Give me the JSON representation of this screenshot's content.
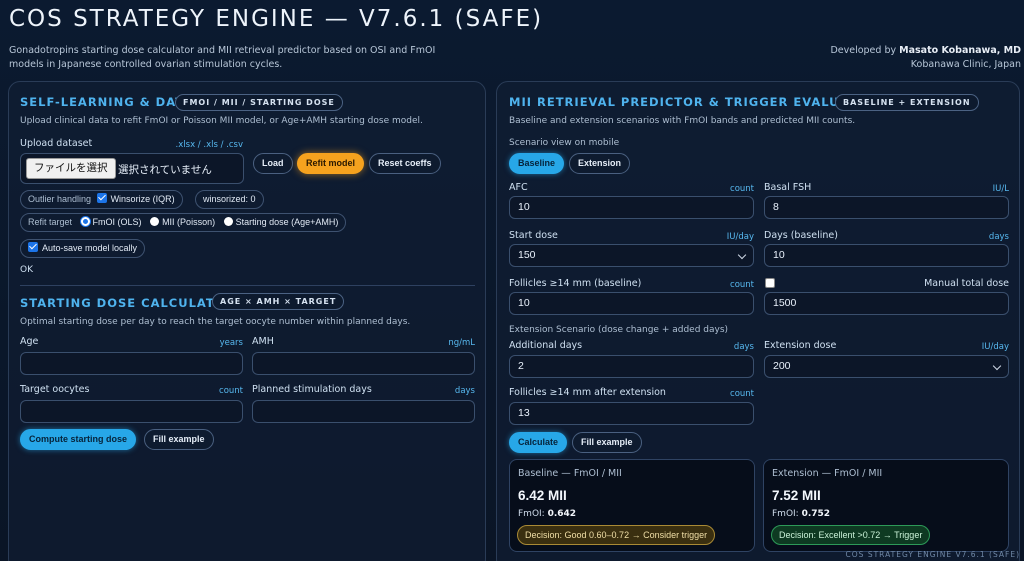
{
  "header": {
    "title": "COS STRATEGY ENGINE — V7.6.1 (SAFE)",
    "subtitle": "Gonadotropins starting dose calculator and MII retrieval predictor based on OSI and FmOI models in Japanese controlled ovarian stimulation cycles.",
    "developed_by_prefix": "Developed by ",
    "developer": "Masato Kobanawa, MD",
    "clinic": "Kobanawa Clinic, Japan"
  },
  "self_learning": {
    "title": "SELF-LEARNING & DATA",
    "tag": "FMOI / MII / STARTING DOSE",
    "desc": "Upload clinical data to refit FmOI or Poisson MII model, or Age+AMH starting dose model.",
    "upload_label": "Upload dataset",
    "upload_formats": ".xlsx / .xls / .csv",
    "file_button": "ファイルを選択",
    "file_none": "選択されていません",
    "load": "Load",
    "refit": "Refit model",
    "reset": "Reset coeffs",
    "outlier_label": "Outlier handling",
    "winsorize_label": "Winsorize (IQR)",
    "winsorize_checked": true,
    "winsorized_count": "winsorized: 0",
    "refit_target_label": "Refit target",
    "refit_options": [
      "FmOI (OLS)",
      "MII (Poisson)",
      "Starting dose (Age+AMH)"
    ],
    "refit_selected": "FmOI (OLS)",
    "autosave_label": "Auto-save model locally",
    "autosave_checked": true,
    "status": "OK"
  },
  "dose_calc": {
    "title": "STARTING DOSE CALCULATOR",
    "tag": "AGE × AMH × TARGET",
    "desc": "Optimal starting dose per day to reach the target oocyte number within planned days.",
    "age_label": "Age",
    "age_unit": "years",
    "age_value": "",
    "amh_label": "AMH",
    "amh_unit": "ng/mL",
    "amh_value": "",
    "target_label": "Target oocytes",
    "target_unit": "count",
    "target_value": "",
    "days_label": "Planned stimulation days",
    "days_unit": "days",
    "days_value": "",
    "compute": "Compute starting dose",
    "fill": "Fill example"
  },
  "predictor": {
    "title": "MII RETRIEVAL PREDICTOR & TRIGGER EVALUATION",
    "tag": "BASELINE + EXTENSION",
    "desc": "Baseline and extension scenarios with FmOI bands and predicted MII counts.",
    "scenario_label": "Scenario view on mobile",
    "tab_baseline": "Baseline",
    "tab_extension": "Extension",
    "afc_label": "AFC",
    "afc_unit": "count",
    "afc_value": "10",
    "fsh_label": "Basal FSH",
    "fsh_unit": "IU/L",
    "fsh_value": "8",
    "start_dose_label": "Start dose",
    "start_dose_unit": "IU/day",
    "start_dose_value": "150",
    "days_label": "Days (baseline)",
    "days_unit": "days",
    "days_value": "10",
    "follicles_label": "Follicles ≥14 mm (baseline)",
    "follicles_unit": "count",
    "follicles_value": "10",
    "manual_total_label": "Manual total dose",
    "manual_total_checked": false,
    "manual_total_value": "1500",
    "extension_scenario": "Extension Scenario (dose change + added days)",
    "add_days_label": "Additional days",
    "add_days_unit": "days",
    "add_days_value": "2",
    "ext_dose_label": "Extension dose",
    "ext_dose_unit": "IU/day",
    "ext_dose_value": "200",
    "follicles_ext_label": "Follicles ≥14 mm after extension",
    "follicles_ext_unit": "count",
    "follicles_ext_value": "13",
    "calculate": "Calculate",
    "fill": "Fill example"
  },
  "results": {
    "baseline": {
      "heading": "Baseline — FmOI / MII",
      "mii": "6.42 MII",
      "fmoi_label": "FmOI: ",
      "fmoi": "0.642",
      "decision": "Decision: Good 0.60–0.72 → Consider trigger",
      "decision_color": "#a98a35"
    },
    "extension": {
      "heading": "Extension — FmOI / MII",
      "mii": "7.52 MII",
      "fmoi_label": "FmOI: ",
      "fmoi": "0.752",
      "decision": "Decision: Excellent >0.72 → Trigger",
      "decision_color": "#2d9a58"
    }
  },
  "footer": "COS STRATEGY ENGINE V7.6.1 (SAFE)",
  "colors": {
    "accent": "#27a7e8",
    "refit": "#f6a21e",
    "heading": "#4fb3ee"
  }
}
